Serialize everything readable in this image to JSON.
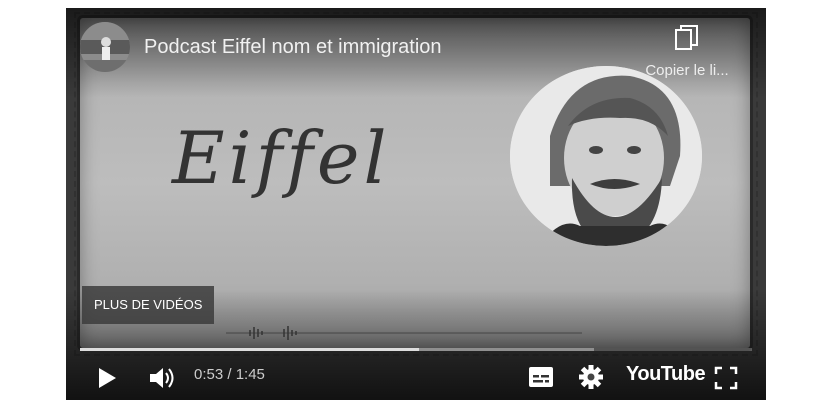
{
  "video": {
    "title": "Podcast Eiffel nom et immigration",
    "copy_link_label": "Copier le li...",
    "overlay_text": "Eiffel",
    "more_videos_label": "PLUS DE VIDÉOS"
  },
  "player": {
    "time_current": "0:53",
    "time_total": "1:45",
    "time_display": "0:53 / 1:45",
    "progress_played_fraction": 0.505,
    "progress_buffered_fraction": 0.765,
    "brand_label": "YouTube"
  },
  "icons": {
    "copy": "copy-icon",
    "play": "play-icon",
    "volume": "volume-icon",
    "subtitles": "subtitles-icon",
    "settings": "gear-icon",
    "fullscreen": "fullscreen-icon"
  },
  "colors": {
    "frame": "#b5b5b5",
    "text_light": "#f1f1f1",
    "progress_played": "#dddddd"
  }
}
